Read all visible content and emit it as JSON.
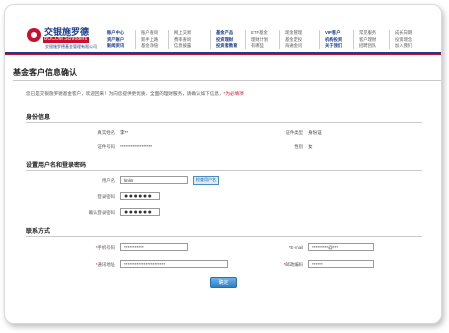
{
  "brand": {
    "name_cn": "交银施罗德",
    "name_en": "BOCOM Schroders",
    "tagline": "交银施罗德基金管理有限公司"
  },
  "nav": {
    "col1": [
      "账户中心",
      "资产账户",
      "新闻资讯"
    ],
    "col2": [
      "账户查询",
      "新手上路",
      "基金净值"
    ],
    "col3": [
      "网上交易",
      "费率查询",
      "信息披露"
    ],
    "col4": [
      "基金产品",
      "投资理财",
      "投资者教育"
    ],
    "col5": [
      "ETF基金",
      "理财计划",
      "有哪些"
    ],
    "col6": [
      "现金管理",
      "基金定投",
      "海通金问"
    ],
    "col7": [
      "VIP客户",
      "机构投资",
      "关于我们"
    ],
    "col8": [
      "常见服务",
      "客户理财",
      "招聘团队"
    ],
    "col9": [
      "成长日期",
      "投资理念",
      "加入我们"
    ]
  },
  "page": {
    "title": "基金客户信息确认",
    "intro": "您已是交银施罗德基金客户，欢迎回来！为向您提供更优质、全面的理财服务，请确认如下信息，",
    "intro_req": "*为必填项"
  },
  "identity": {
    "heading": "身份信息",
    "name_label": "真实姓名",
    "name_value": "李**",
    "idtype_label": "证件类型",
    "idtype_value": "身份证",
    "idno_label": "证件号码",
    "idno_value": "******************",
    "gender_label": "性别",
    "gender_value": "女"
  },
  "login": {
    "heading": "设置用户名和登录密码",
    "username_label": "用户名",
    "username_value": "linlin",
    "username_tag": "检查用户名",
    "password_label": "登录密码",
    "password_value": "●●●●●●",
    "confirm_label": "确认登录密码",
    "confirm_value": "●●●●●●"
  },
  "contact": {
    "heading": "联系方式",
    "mobile_label": "手机号码",
    "mobile_value": "***********",
    "email_label": "E-mail",
    "email_value": "*********@***",
    "address_label": "通讯地址",
    "address_value": "***********************",
    "zip_label": "邮政编码",
    "zip_value": "******"
  },
  "actions": {
    "confirm_label": "确定"
  },
  "colors": {
    "brand_blue": "#1a3d8f",
    "brand_red": "#c8102e",
    "button_blue": "#2f7fc4"
  }
}
